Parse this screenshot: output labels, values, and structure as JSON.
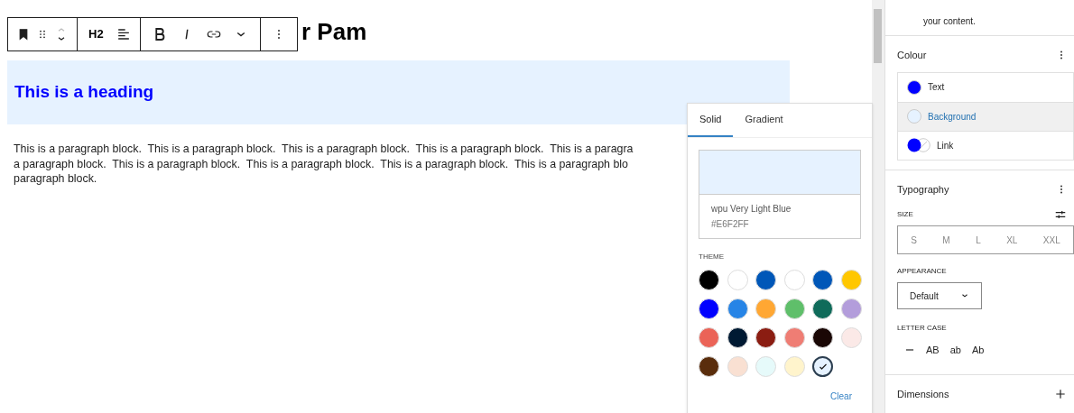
{
  "editor": {
    "title_visible": "r Pam",
    "toolbar": {
      "heading_level": "H2"
    },
    "heading": {
      "text": "This is a heading",
      "color": "#0000ff"
    },
    "paragraph_lines": [
      "This is a paragraph block.  This is a paragraph block.  This is a paragraph block.  This is a paragraph block.  This is a paragra",
      "a paragraph block.  This is a paragraph block.  This is a paragraph block.  This is a paragraph block.  This is a paragraph blo",
      "paragraph block."
    ]
  },
  "color_popover": {
    "tabs": [
      {
        "label": "Solid",
        "selected": true
      },
      {
        "label": "Gradient",
        "selected": false
      }
    ],
    "preview": {
      "color": "#e6f2ff",
      "name": "wpu Very Light Blue",
      "hex": "#E6F2FF"
    },
    "theme_label": "THEME",
    "swatches": [
      {
        "color": "#000000",
        "selected": false
      },
      {
        "color": "#ffffff",
        "selected": false
      },
      {
        "color": "#0057b8",
        "selected": false
      },
      {
        "color": "#ffffff",
        "selected": false
      },
      {
        "color": "#0057b8",
        "selected": false
      },
      {
        "color": "#ffc700",
        "selected": false
      },
      {
        "color": "#0000ff",
        "selected": false
      },
      {
        "color": "#2684e6",
        "selected": false
      },
      {
        "color": "#ffa733",
        "selected": false
      },
      {
        "color": "#5fbf6a",
        "selected": false
      },
      {
        "color": "#0f6b5a",
        "selected": false
      },
      {
        "color": "#b39ddb",
        "selected": false
      },
      {
        "color": "#eb6357",
        "selected": false
      },
      {
        "color": "#001a33",
        "selected": false
      },
      {
        "color": "#8b1d12",
        "selected": false
      },
      {
        "color": "#ef7d74",
        "selected": false
      },
      {
        "color": "#1a0705",
        "selected": false
      },
      {
        "color": "#fbe9e7",
        "selected": false
      },
      {
        "color": "#5a2d0c",
        "selected": false
      },
      {
        "color": "#f9e0d2",
        "selected": false
      },
      {
        "color": "#e6fafa",
        "selected": false
      },
      {
        "color": "#fff4cc",
        "selected": false
      },
      {
        "color": "#e6f2ff",
        "selected": true
      }
    ],
    "clear_label": "Clear"
  },
  "sidebar": {
    "intro_tail": "your content.",
    "colour": {
      "title": "Colour",
      "items": [
        {
          "kind": "solid",
          "label": "Text",
          "color": "#0000ff",
          "selected": false
        },
        {
          "kind": "solid",
          "label": "Background",
          "color": "#e6f2ff",
          "selected": true
        },
        {
          "kind": "split",
          "label": "Link",
          "color": "#0000ff",
          "selected": false
        }
      ]
    },
    "typography": {
      "title": "Typography",
      "size_label": "SIZE",
      "sizes": [
        "S",
        "M",
        "L",
        "XL",
        "XXL"
      ],
      "appearance_label": "APPEARANCE",
      "appearance_value": "Default",
      "letter_case_label": "LETTER CASE",
      "letter_cases": [
        "AB",
        "ab",
        "Ab"
      ]
    },
    "dimensions": {
      "title": "Dimensions"
    }
  }
}
